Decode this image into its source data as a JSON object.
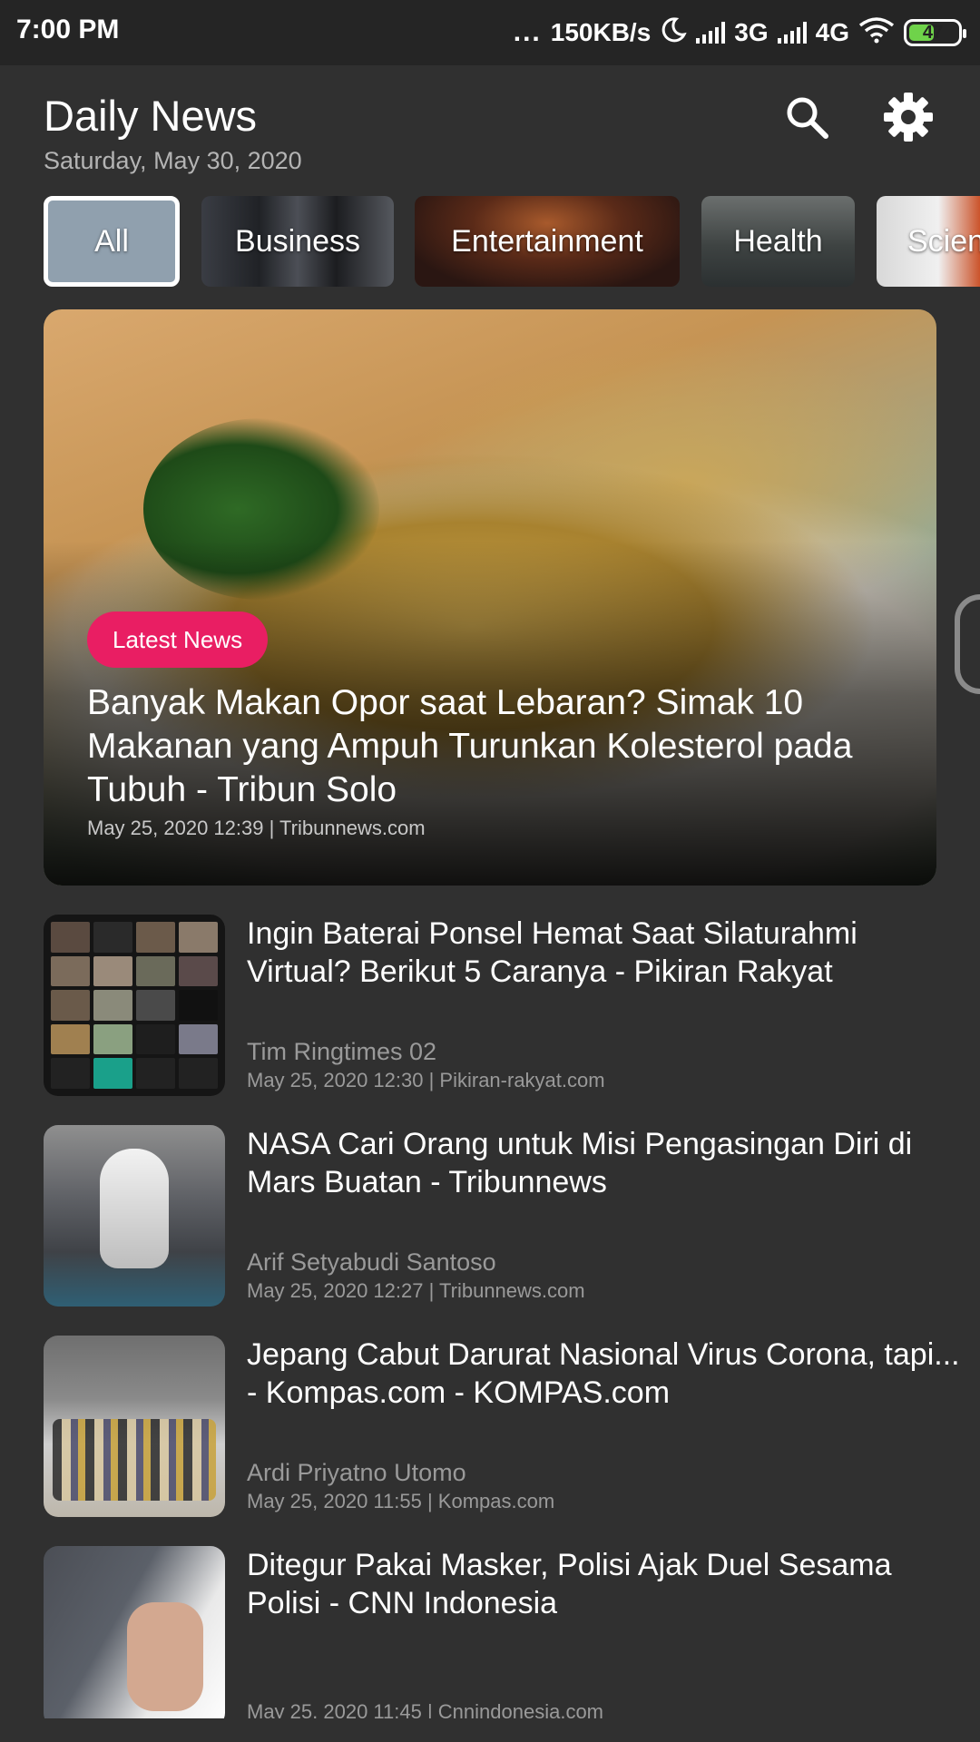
{
  "status_bar": {
    "time": "7:00 PM",
    "dots": "...",
    "speed": "150KB/s",
    "net1": "3G",
    "net2": "4G",
    "battery": "47",
    "battery_color": "#6fd34a"
  },
  "header": {
    "title": "Daily News",
    "date": "Saturday, May 30, 2020",
    "search_icon": "search-icon",
    "settings_icon": "gear-icon"
  },
  "categories": [
    {
      "label": "All",
      "selected": true
    },
    {
      "label": "Business"
    },
    {
      "label": "Entertainment"
    },
    {
      "label": "Health"
    },
    {
      "label": "Scien"
    }
  ],
  "hero": {
    "badge": "Latest News",
    "badge_color": "#e91e63",
    "title": "Banyak Makan Opor saat Lebaran? Simak 10 Makanan yang Ampuh Turunkan Kolesterol pada Tubuh - Tribun Solo",
    "meta": "May 25, 2020 12:39 | Tribunnews.com"
  },
  "articles": [
    {
      "title": "Ingin Baterai Ponsel Hemat Saat Silaturahmi Virtual? Berikut 5 Caranya - Pikiran Rakyat",
      "author": "Tim Ringtimes 02",
      "meta": "May 25, 2020 12:30 | Pikiran-rakyat.com"
    },
    {
      "title": "NASA Cari Orang untuk Misi Pengasingan Diri di Mars Buatan - Tribunnews",
      "author": "Arif Setyabudi Santoso",
      "meta": "May 25, 2020 12:27 | Tribunnews.com"
    },
    {
      "title": "Jepang Cabut Darurat Nasional Virus Corona, tapi... - Kompas.com - KOMPAS.com",
      "author": "Ardi Priyatno Utomo",
      "meta": "May 25, 2020 11:55 | Kompas.com"
    },
    {
      "title": "Ditegur Pakai Masker, Polisi Ajak Duel Sesama Polisi - CNN Indonesia",
      "author": "",
      "meta": "May 25, 2020 11:45 | Cnnindonesia.com"
    }
  ]
}
